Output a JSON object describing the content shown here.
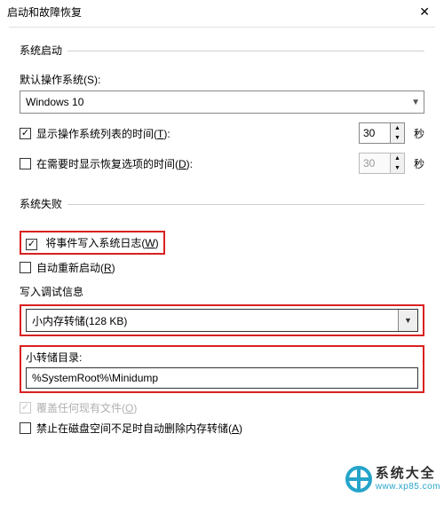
{
  "window": {
    "title": "启动和故障恢复"
  },
  "startup": {
    "group_title": "系统启动",
    "default_os_label": "默认操作系统(S):",
    "default_os_value": "Windows 10",
    "show_os_list": {
      "checked": true,
      "label_pre": "显示操作系统列表的时间(",
      "hotkey": "T",
      "label_post": "):",
      "value": "30",
      "unit": "秒"
    },
    "show_recovery": {
      "checked": false,
      "label_pre": "在需要时显示恢复选项的时间(",
      "hotkey": "D",
      "label_post": "):",
      "value": "30",
      "unit": "秒"
    }
  },
  "failure": {
    "group_title": "系统失败",
    "write_event": {
      "checked": true,
      "label_pre": "将事件写入系统日志(",
      "hotkey": "W",
      "label_post": ")"
    },
    "auto_restart": {
      "checked": false,
      "label_pre": "自动重新启动(",
      "hotkey": "R",
      "label_post": ")"
    },
    "debug_info_label": "写入调试信息",
    "dump_type": "小内存转储(128 KB)",
    "dump_dir_label": "小转储目录:",
    "dump_dir_value": "%SystemRoot%\\Minidump",
    "overwrite": {
      "checked": true,
      "label_pre": "覆盖任何现有文件(",
      "hotkey": "O",
      "label_post": ")"
    },
    "disable_lowdisk": {
      "checked": false,
      "label_pre": "禁止在磁盘空间不足时自动删除内存转储(",
      "hotkey": "A",
      "label_post": ")"
    }
  },
  "watermark": {
    "cn": "系统大全",
    "en": "www.xp85.com"
  }
}
